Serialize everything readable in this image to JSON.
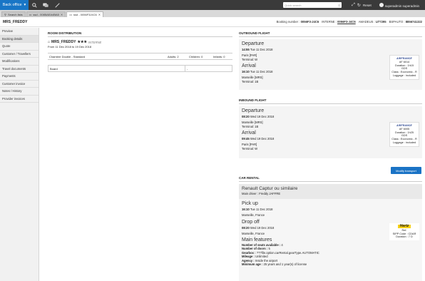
{
  "topbar": {
    "brand": "Back office",
    "search_placeholder": "Quick search",
    "reset": "Reset",
    "user": "superadmin superadmin"
  },
  "tabs": [
    {
      "label": "Search lists"
    },
    {
      "label": "ssd - 0085AEA4BA5"
    },
    {
      "label": "ssd - 0056F3J4C6"
    }
  ],
  "header": {
    "title": "MRS_FREDDY",
    "booking_label": "Booking number :",
    "booking_value": "0056F3-J4C6",
    "interne_label": "INTERNE :",
    "interne_value": "0056F3-J4C6",
    "amadeus_label": "AMADEUS :",
    "amadeus_value": "U77295",
    "bspauto_label": "BSPAUTO :",
    "bspauto_value": "8856741322"
  },
  "sidebar": {
    "items": [
      {
        "label": "Preview"
      },
      {
        "label": "Booking details"
      },
      {
        "label": "Quote"
      },
      {
        "label": "Customer / Travellers"
      },
      {
        "label": "Modifications"
      },
      {
        "label": "Travel documents"
      },
      {
        "label": "Payments"
      },
      {
        "label": "Customer invoice"
      },
      {
        "label": "Notes / History"
      },
      {
        "label": "Provider invoices"
      }
    ]
  },
  "room": {
    "section_title": "ROOM DISTRIBUTION",
    "name": "MRS_FREDDY",
    "stars": "★★★",
    "tag": "INTERNE",
    "dates": "From 11 Dec 2018 to 19 Dec 2018",
    "room_type": "Chambre Double - Standard",
    "adults": "Adults: 2",
    "children": "Children: 0",
    "infants": "Infants: 0",
    "board_label": "Board",
    "board_value": "-"
  },
  "outbound": {
    "section_title": "OUTBOUND FLIGHT",
    "dep_label": "Departure",
    "dep_time": "14:55",
    "dep_date": "Tue 11 Dec 2018",
    "dep_city": "Paris [PAR]",
    "dep_terminal": "Terminal: W",
    "arr_label": "Arrival",
    "arr_time": "16:10",
    "arr_date": "Tue 11 Dec 2018",
    "arr_city": "Marseille [MRS]",
    "arr_terminal": "Terminal: 1B",
    "airline_logo": "AIRFRANCE",
    "flight_no": "AF 6014",
    "duration": "Duration : 1h15",
    "gds": "GDS",
    "class": "Class : Economic - R",
    "luggage": "Luggage : included"
  },
  "inbound": {
    "section_title": "INBOUND FLIGHT",
    "dep_label": "Departure",
    "dep_time": "08:20",
    "dep_date": "Wed 19 Dec 2018",
    "dep_city": "Marseille [MRS]",
    "dep_terminal": "Terminal: 1B",
    "arr_label": "Arrival",
    "arr_time": "09:45",
    "arr_date": "Wed 19 Dec 2018",
    "arr_city": "Paris [PAR]",
    "arr_terminal": "Terminal: W",
    "airline_logo": "AIRFRANCE",
    "flight_no": "AF 6005",
    "duration": "Duration : 1h25",
    "gds": "GDS",
    "class": "Class : Economic - R",
    "luggage": "Luggage : included"
  },
  "modify_transport": "Modify transport",
  "car": {
    "section_title": "CAR RENTAL",
    "name": "Renault Captur ou similaire",
    "driver": "Main driver : Freddy JAFFRE",
    "pickup_label": "Pick up",
    "pickup_time": "16:10",
    "pickup_date": "Tue 11 Dec 2018",
    "pickup_place": "Marseille, France",
    "dropoff_label": "Drop off",
    "dropoff_time": "08:20",
    "dropoff_date": "Wed 19 Dec 2018",
    "dropoff_place": "Marseille, France",
    "logo": "Hertz",
    "ref": "Ref.",
    "sipp": "SIPP Code : CDAR",
    "duration": "Duration : 7 D",
    "features_label": "Main features",
    "seats_label": "Number of seats available :",
    "seats_value": "4",
    "doors_label": "Number of doors :",
    "doors_value": "5",
    "gearbox_label": "Gearbox :",
    "gearbox_value": "???file.option.carRental.gearType.AUTOMATIC",
    "mileage_label": "Mileage :",
    "mileage_value": "Unlimited",
    "agency_label": "Agency :",
    "agency_value": "Inside the airport",
    "minage_label": "Minimum age :",
    "minage_value": "25 years and 1 year(s) of license"
  }
}
